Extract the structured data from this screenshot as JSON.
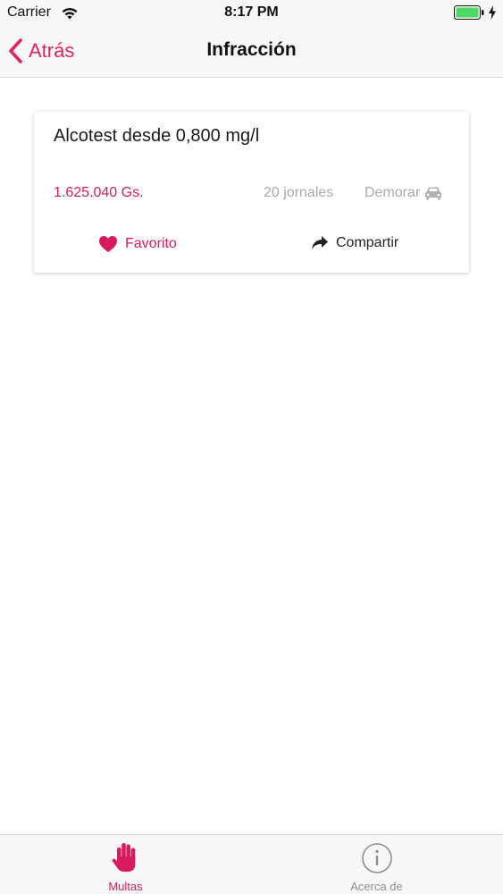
{
  "status_bar": {
    "carrier": "Carrier",
    "time": "8:17 PM"
  },
  "nav": {
    "back_label": "Atrás",
    "title": "Infracción"
  },
  "card": {
    "title": "Alcotest desde 0,800 mg/l",
    "price": "1.625.040 Gs.",
    "jornales": "20 jornales",
    "demorar": "Demorar",
    "favorite_label": "Favorito",
    "share_label": "Compartir"
  },
  "tab_bar": {
    "tabs": [
      {
        "label": "Multas",
        "icon": "hand-icon",
        "active": true
      },
      {
        "label": "Acerca de",
        "icon": "info-icon",
        "active": false
      }
    ]
  },
  "colors": {
    "accent": "#d81b60",
    "secondary_text": "#aaaaaa",
    "inactive_tab": "#8e8e93",
    "battery": "#4cd964"
  }
}
